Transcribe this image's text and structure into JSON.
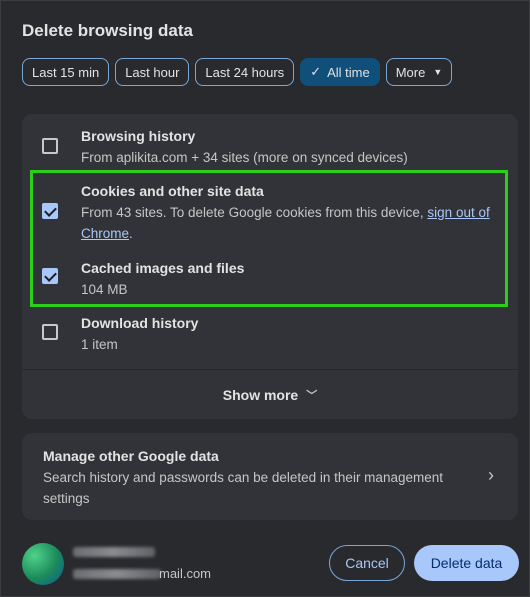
{
  "dialog": {
    "title": "Delete browsing data"
  },
  "time_range": {
    "options": [
      {
        "label": "Last 15 min",
        "selected": false
      },
      {
        "label": "Last hour",
        "selected": false
      },
      {
        "label": "Last 24 hours",
        "selected": false
      },
      {
        "label": "All time",
        "selected": true
      },
      {
        "label": "More",
        "selected": false
      }
    ]
  },
  "data_types": [
    {
      "title": "Browsing history",
      "subtitle": "From aplikita.com + 34 sites (more on synced devices)",
      "checked": false
    },
    {
      "title": "Cookies and other site data",
      "subtitle_before_link": "From 43 sites. To delete Google cookies from this device, ",
      "link_text": "sign out of Chrome",
      "subtitle_after_link": ".",
      "checked": true
    },
    {
      "title": "Cached images and files",
      "subtitle": "104 MB",
      "checked": true
    },
    {
      "title": "Download history",
      "subtitle": "1 item",
      "checked": false
    }
  ],
  "show_more": {
    "label": "Show more"
  },
  "manage": {
    "title": "Manage other Google data",
    "subtitle": "Search history and passwords can be deleted in their management settings"
  },
  "account": {
    "email_suffix": "mail.com"
  },
  "buttons": {
    "cancel": "Cancel",
    "delete": "Delete data"
  },
  "colors": {
    "accent": "#a8c7fa",
    "selected_chip": "#0f4f7a",
    "highlight": "#2bcf1a"
  }
}
